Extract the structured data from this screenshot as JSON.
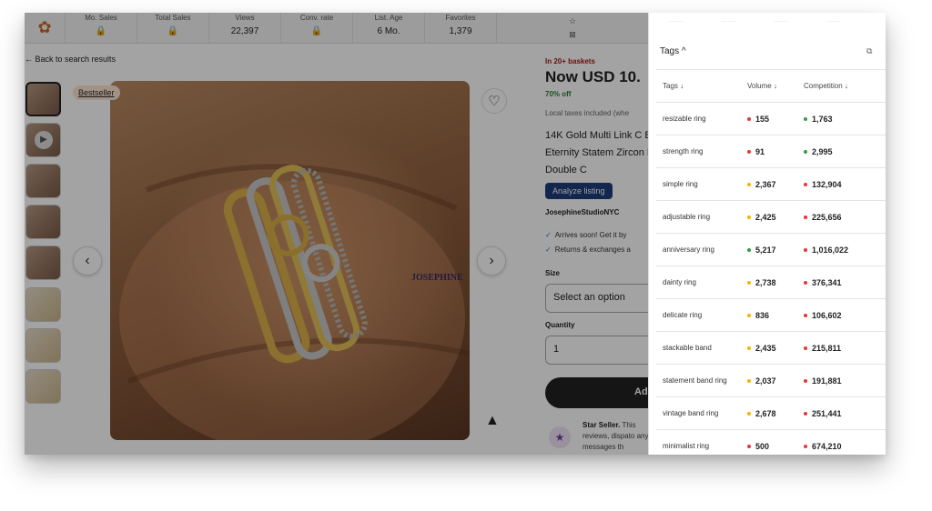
{
  "colors": {
    "red": "#e53935",
    "green": "#2e9e44",
    "yellow": "#f5b400"
  },
  "stats_bar": {
    "logo_icon": "bee-logo-icon",
    "items": [
      {
        "label": "Mo. Sales",
        "value": "🔒"
      },
      {
        "label": "Total Sales",
        "value": "🔒"
      },
      {
        "label": "Views",
        "value": "22,397"
      },
      {
        "label": "Conv. rate",
        "value": "🔒"
      },
      {
        "label": "List. Age",
        "value": "6 Mo."
      },
      {
        "label": "Favorites",
        "value": "1,379"
      }
    ],
    "star_glyph": "☆",
    "close_glyph": "⊠"
  },
  "back_link": "← Back to search results",
  "bestseller_badge": "Bestseller",
  "carousel": {
    "prev_glyph": "‹",
    "next_glyph": "›",
    "play_glyph": "▶"
  },
  "favorite_glyph": "♡",
  "watermark_text": "JOSEPHINE",
  "brand_glyph": "▲",
  "product": {
    "baskets": "In 20+ baskets",
    "price": "Now USD 10.",
    "discount": "70% off",
    "taxes": "Local taxes included (whe",
    "title": "14K Gold Multi Link C Band, Eternity Statem Zircon Ring, Double C",
    "analyze_button": "Analyze listing",
    "shop_name": "JosephineStudioNYC",
    "arrival": "Arrives soon! Get it by",
    "returns": "Returns & exchanges a",
    "size_label": "Size",
    "size_value": "Select an option",
    "quantity_label": "Quantity",
    "quantity_value": "1",
    "add_button": "Ad",
    "star_seller_title": "Star Seller.",
    "star_seller_text": "This reviews, dispato any messages th"
  },
  "tags_panel": {
    "header": "Tags ^",
    "ghost_header": "____ ____ ____ ____",
    "columns": [
      "Tags ↓",
      "Volume ↓",
      "Competition ↓"
    ],
    "rows": [
      {
        "tag": "resizable ring",
        "volume": "155",
        "volume_level": "red",
        "competition": "1,763",
        "competition_level": "green"
      },
      {
        "tag": "strength ring",
        "volume": "91",
        "volume_level": "red",
        "competition": "2,995",
        "competition_level": "green"
      },
      {
        "tag": "simple ring",
        "volume": "2,367",
        "volume_level": "yellow",
        "competition": "132,904",
        "competition_level": "red"
      },
      {
        "tag": "adjustable ring",
        "volume": "2,425",
        "volume_level": "yellow",
        "competition": "225,656",
        "competition_level": "red"
      },
      {
        "tag": "anniversary ring",
        "volume": "5,217",
        "volume_level": "green",
        "competition": "1,016,022",
        "competition_level": "red"
      },
      {
        "tag": "dainty ring",
        "volume": "2,738",
        "volume_level": "yellow",
        "competition": "376,341",
        "competition_level": "red"
      },
      {
        "tag": "delicate ring",
        "volume": "836",
        "volume_level": "yellow",
        "competition": "106,602",
        "competition_level": "red"
      },
      {
        "tag": "stackable band",
        "volume": "2,435",
        "volume_level": "yellow",
        "competition": "215,811",
        "competition_level": "red"
      },
      {
        "tag": "statement band ring",
        "volume": "2,037",
        "volume_level": "yellow",
        "competition": "191,881",
        "competition_level": "red"
      },
      {
        "tag": "vintage band ring",
        "volume": "2,678",
        "volume_level": "yellow",
        "competition": "251,441",
        "competition_level": "red"
      },
      {
        "tag": "minimalist ring",
        "volume": "500",
        "volume_level": "red",
        "competition": "674,210",
        "competition_level": "red"
      }
    ]
  }
}
